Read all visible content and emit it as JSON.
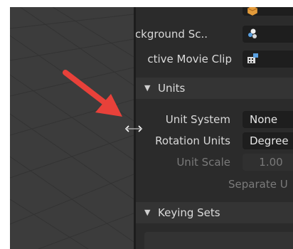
{
  "properties": {
    "rows": [
      {
        "label": "Background Sc..",
        "icon": "scene-objects-icon"
      },
      {
        "label": "ctive Movie Clip",
        "icon": "movie-clip-icon"
      }
    ],
    "units_section": {
      "title": "Units",
      "unit_system": {
        "label": "Unit System",
        "value": "None"
      },
      "rotation_units": {
        "label": "Rotation Units",
        "value": "Degree"
      },
      "unit_scale": {
        "label": "Unit Scale",
        "value": "1.00"
      },
      "separate_units": {
        "label": "Separate U"
      }
    },
    "keying_section": {
      "title": "Keying Sets"
    }
  },
  "annotation": {
    "arrow_color": "#e8413a"
  },
  "colors": {
    "panel_bg": "#2b2b2b",
    "section_bg": "#343434",
    "viewport_bg": "#3c3c3c"
  }
}
